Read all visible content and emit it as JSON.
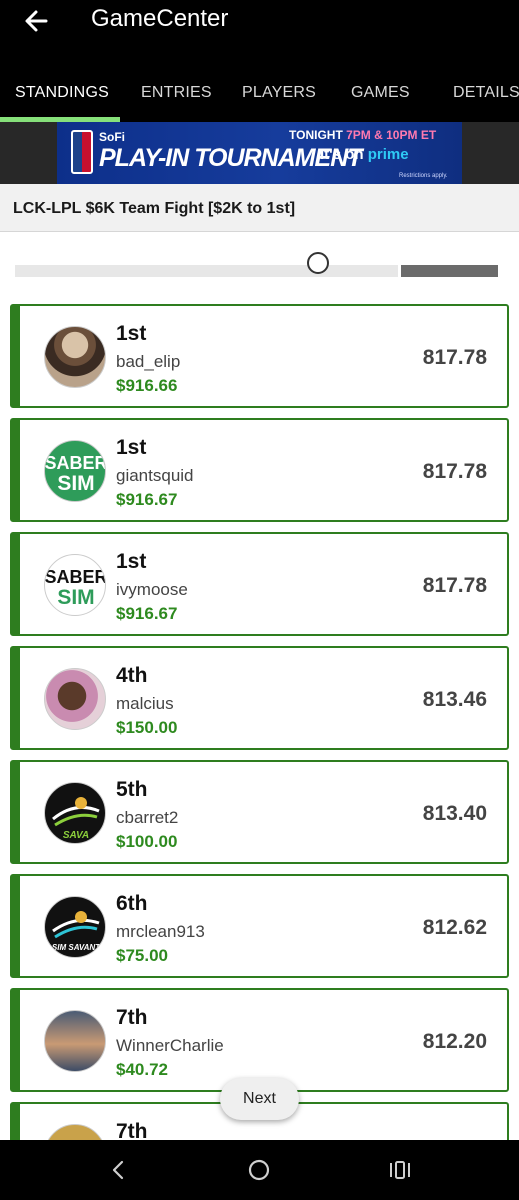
{
  "app": {
    "title": "GameCenter"
  },
  "tabs": [
    {
      "label": "STANDINGS",
      "active": true
    },
    {
      "label": "ENTRIES",
      "active": false
    },
    {
      "label": "PLAYERS",
      "active": false
    },
    {
      "label": "GAMES",
      "active": false
    },
    {
      "label": "DETAILS",
      "active": false
    }
  ],
  "banner": {
    "sponsor": "SoFi",
    "headline": "PLAY-IN TOURNAMENT",
    "tonight": "TONIGHT",
    "times": "7PM & 10PM ET",
    "on": "It's on",
    "prime": "prime",
    "restrictions": "Restrictions apply."
  },
  "contest": {
    "title": "LCK-LPL $6K Team Fight [$2K to 1st]"
  },
  "standings": [
    {
      "rank": "1st",
      "username": "bad_elip",
      "prize": "$916.66",
      "score": "817.78",
      "avatar": "photo-avatar"
    },
    {
      "rank": "1st",
      "username": "giantsquid",
      "prize": "$916.67",
      "score": "817.78",
      "avatar": "sabersim-logo",
      "avatar_text": "SABER SIM"
    },
    {
      "rank": "1st",
      "username": "ivymoose",
      "prize": "$916.67",
      "score": "817.78",
      "avatar": "sabersim-logo",
      "avatar_text": "SABER SIM"
    },
    {
      "rank": "4th",
      "username": "malcius",
      "prize": "$150.00",
      "score": "813.46",
      "avatar": "photo-avatar"
    },
    {
      "rank": "5th",
      "username": "cbarret2",
      "prize": "$100.00",
      "score": "813.40",
      "avatar": "sava-logo",
      "avatar_text": "SAVA"
    },
    {
      "rank": "6th",
      "username": "mrclean913",
      "prize": "$75.00",
      "score": "812.62",
      "avatar": "simsavant-logo",
      "avatar_text": "SIM SAVANT"
    },
    {
      "rank": "7th",
      "username": "WinnerCharlie",
      "prize": "$40.72",
      "score": "812.20",
      "avatar": "photo-avatar"
    },
    {
      "rank": "7th",
      "username": "",
      "prize": "",
      "score": "",
      "avatar": "photo-avatar"
    }
  ],
  "next_button": {
    "label": "Next"
  },
  "icons": {
    "back": "arrow-left-icon",
    "nav_back": "chevron-left-icon",
    "nav_home": "circle-home-icon",
    "nav_recents": "recents-icon"
  },
  "colors": {
    "accent": "#2e7d1f",
    "prize": "#2e8a1f",
    "tab_indicator": "#86e07a"
  }
}
